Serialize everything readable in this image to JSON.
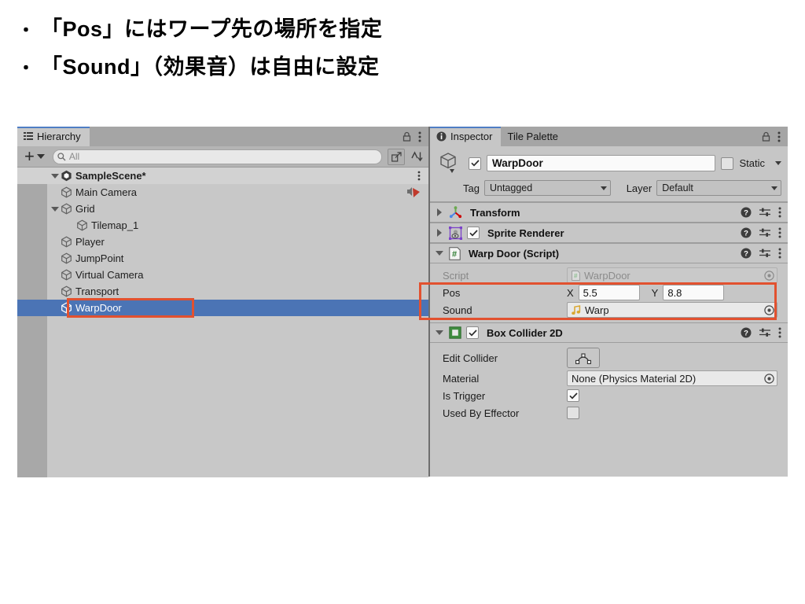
{
  "slide": {
    "bullets": [
      {
        "marker": "・",
        "text": "「Pos」にはワープ先の場所を指定"
      },
      {
        "marker": "・",
        "text": "「Sound」（効果音）は自由に設定"
      }
    ]
  },
  "hierarchy": {
    "tab_label": "Hierarchy",
    "tab_icon": "list-icon",
    "lock_icon": "lock-icon",
    "menu_icon": "kebab-menu-icon",
    "toolbar": {
      "add_label": "+",
      "add_icon": "plus-icon",
      "search_icon": "search-icon",
      "search_value": "All",
      "search_placeholder": "All",
      "expand_icon": "open-in-new-icon",
      "sort_icon": "sort-icon"
    },
    "scene": {
      "label": "SampleScene*",
      "icon": "unity-scene-icon",
      "menu_icon": "kebab-menu-icon"
    },
    "items": [
      {
        "label": "Main Camera",
        "depth": 1,
        "icon": "gameobject-icon",
        "expandable": false,
        "selected": false,
        "badge_icon": "audio-listener-icon"
      },
      {
        "label": "Grid",
        "depth": 1,
        "icon": "gameobject-icon",
        "expandable": true,
        "selected": false,
        "badge_icon": ""
      },
      {
        "label": "Tilemap_1",
        "depth": 2,
        "icon": "gameobject-icon",
        "expandable": false,
        "selected": false,
        "badge_icon": ""
      },
      {
        "label": "Player",
        "depth": 1,
        "icon": "gameobject-icon",
        "expandable": false,
        "selected": false,
        "badge_icon": ""
      },
      {
        "label": "JumpPoint",
        "depth": 1,
        "icon": "gameobject-icon",
        "expandable": false,
        "selected": false,
        "badge_icon": ""
      },
      {
        "label": "Virtual Camera",
        "depth": 1,
        "icon": "gameobject-icon",
        "expandable": false,
        "selected": false,
        "badge_icon": ""
      },
      {
        "label": "Transport",
        "depth": 1,
        "icon": "gameobject-icon",
        "expandable": false,
        "selected": false,
        "badge_icon": ""
      },
      {
        "label": "WarpDoor",
        "depth": 1,
        "icon": "gameobject-icon",
        "expandable": false,
        "selected": true,
        "badge_icon": ""
      }
    ]
  },
  "inspector": {
    "tabs": [
      {
        "label": "Inspector",
        "icon": "info-icon",
        "active": true
      },
      {
        "label": "Tile Palette",
        "icon": "",
        "active": false
      }
    ],
    "lock_icon": "lock-icon",
    "menu_icon": "kebab-menu-icon",
    "gameobject": {
      "icon": "gameobject-icon",
      "enabled": true,
      "name_value": "WarpDoor",
      "static_label": "Static",
      "static_checked": false,
      "tag_label": "Tag",
      "tag_value": "Untagged",
      "layer_label": "Layer",
      "layer_value": "Default"
    },
    "components": [
      {
        "title": "Transform",
        "icon": "transform-icon",
        "expanded": false,
        "has_enable_toggle": false,
        "enabled": false,
        "help_icon": "help-icon",
        "preset_icon": "preset-icon",
        "menu_icon": "kebab-menu-icon"
      },
      {
        "title": "Sprite Renderer",
        "icon": "sprite-renderer-icon",
        "expanded": false,
        "has_enable_toggle": true,
        "enabled": true,
        "help_icon": "help-icon",
        "preset_icon": "preset-icon",
        "menu_icon": "kebab-menu-icon"
      },
      {
        "title": "Warp Door (Script)",
        "icon": "script-icon",
        "expanded": true,
        "has_enable_toggle": false,
        "enabled": false,
        "help_icon": "help-icon",
        "preset_icon": "preset-icon",
        "menu_icon": "kebab-menu-icon"
      }
    ],
    "script_props": {
      "script_label": "Script",
      "script_value": "WarpDoor",
      "script_value_icon": "script-icon",
      "script_picker_icon": "object-picker-icon",
      "pos_label": "Pos",
      "pos_x_label": "X",
      "pos_x_value": "5.5",
      "pos_y_label": "Y",
      "pos_y_value": "8.8",
      "sound_label": "Sound",
      "sound_value": "Warp",
      "sound_value_icon": "audioclip-icon",
      "sound_picker_icon": "object-picker-icon"
    },
    "collider": {
      "title": "Box Collider 2D",
      "icon": "box-collider-2d-icon",
      "enabled": true,
      "help_icon": "help-icon",
      "preset_icon": "preset-icon",
      "menu_icon": "kebab-menu-icon",
      "edit_collider_label": "Edit Collider",
      "edit_collider_icon": "edit-collider-icon",
      "material_label": "Material",
      "material_value": "None (Physics Material 2D)",
      "material_picker_icon": "object-picker-icon",
      "is_trigger_label": "Is Trigger",
      "is_trigger_checked": true,
      "used_by_effector_label": "Used By Effector",
      "used_by_effector_checked": false
    }
  },
  "annotations": {
    "highlight_color": "#e2512f",
    "boxes": [
      "hierarchy-warpdoor-highlight",
      "inspector-pos-sound-highlight"
    ]
  },
  "colors": {
    "selection_blue": "#4b74b5",
    "panel_gray": "#c6c6c6",
    "tabbar_gray": "#a5a5a5",
    "accent_tab": "#4f7ec4",
    "annotation_red": "#e2512f"
  }
}
